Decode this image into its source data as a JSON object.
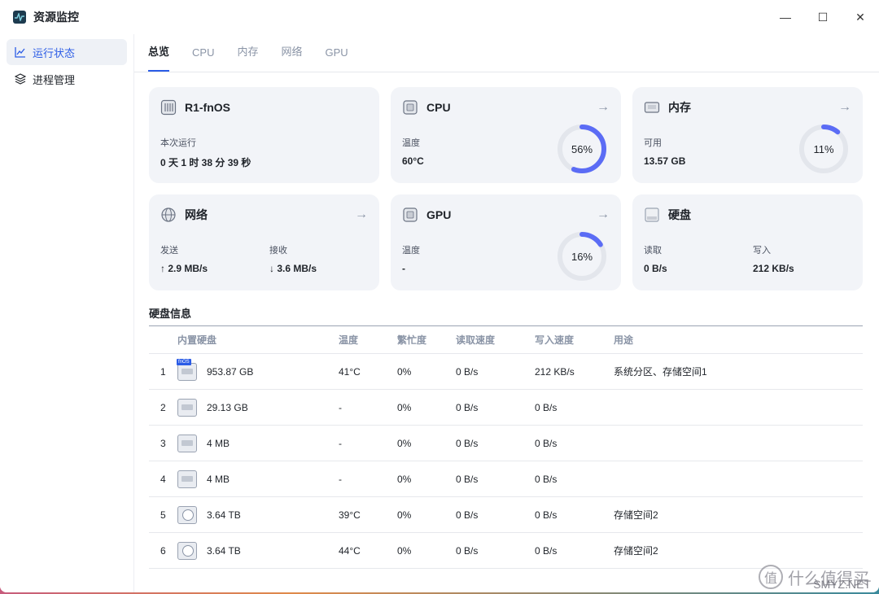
{
  "window": {
    "title": "资源监控",
    "controls": {
      "minimize": "—",
      "maximize": "☐",
      "close": "✕"
    }
  },
  "sidebar": {
    "items": [
      {
        "label": "运行状态",
        "icon": "line-chart-icon",
        "active": true
      },
      {
        "label": "进程管理",
        "icon": "layers-icon",
        "active": false
      }
    ]
  },
  "tabs": [
    {
      "label": "总览",
      "active": true
    },
    {
      "label": "CPU",
      "active": false
    },
    {
      "label": "内存",
      "active": false
    },
    {
      "label": "网络",
      "active": false
    },
    {
      "label": "GPU",
      "active": false
    }
  ],
  "cards": {
    "system": {
      "title": "R1-fnOS",
      "uptime_label": "本次运行",
      "uptime_value": "0 天 1 时 38 分 39 秒"
    },
    "cpu": {
      "title": "CPU",
      "stat_label": "温度",
      "stat_value": "60°C",
      "percent": 56,
      "percent_text": "56%"
    },
    "memory": {
      "title": "内存",
      "stat_label": "可用",
      "stat_value": "13.57 GB",
      "percent": 11,
      "percent_text": "11%"
    },
    "network": {
      "title": "网络",
      "send_label": "发送",
      "send_value": "↑ 2.9 MB/s",
      "recv_label": "接收",
      "recv_value": "↓ 3.6 MB/s"
    },
    "gpu": {
      "title": "GPU",
      "stat_label": "温度",
      "stat_value": "-",
      "percent": 16,
      "percent_text": "16%"
    },
    "disk": {
      "title": "硬盘",
      "read_label": "读取",
      "read_value": "0 B/s",
      "write_label": "写入",
      "write_value": "212 KB/s"
    }
  },
  "disk_section": {
    "title": "硬盘信息",
    "headers": [
      "",
      "内置硬盘",
      "温度",
      "繁忙度",
      "读取速度",
      "写入速度",
      "用途"
    ],
    "rows": [
      {
        "index": "1",
        "kind": "ssd",
        "tag": "fnOS",
        "size": "953.87 GB",
        "temp": "41°C",
        "busy": "0%",
        "read": "0 B/s",
        "write": "212 KB/s",
        "usage": "系统分区、存储空间1"
      },
      {
        "index": "2",
        "kind": "ssd",
        "tag": "",
        "size": "29.13 GB",
        "temp": "-",
        "busy": "0%",
        "read": "0 B/s",
        "write": "0 B/s",
        "usage": ""
      },
      {
        "index": "3",
        "kind": "ssd",
        "tag": "",
        "size": "4 MB",
        "temp": "-",
        "busy": "0%",
        "read": "0 B/s",
        "write": "0 B/s",
        "usage": ""
      },
      {
        "index": "4",
        "kind": "ssd",
        "tag": "",
        "size": "4 MB",
        "temp": "-",
        "busy": "0%",
        "read": "0 B/s",
        "write": "0 B/s",
        "usage": ""
      },
      {
        "index": "5",
        "kind": "hdd",
        "tag": "",
        "size": "3.64 TB",
        "temp": "39°C",
        "busy": "0%",
        "read": "0 B/s",
        "write": "0 B/s",
        "usage": "存储空间2"
      },
      {
        "index": "6",
        "kind": "hdd",
        "tag": "",
        "size": "3.64 TB",
        "temp": "44°C",
        "busy": "0%",
        "read": "0 B/s",
        "write": "0 B/s",
        "usage": "存储空间2"
      }
    ]
  },
  "colors": {
    "accent": "#2b5ce6",
    "ring": "#5b6cf5",
    "ring_track": "#e3e6ec"
  },
  "watermark": {
    "text": "值 什么值得买",
    "url": "SMYZ.NET"
  }
}
